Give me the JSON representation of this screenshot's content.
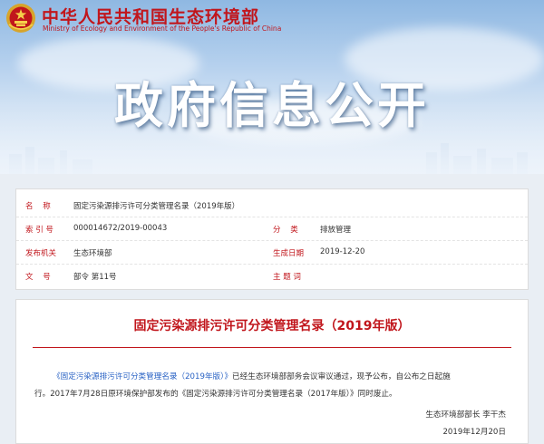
{
  "header": {
    "ministry_cn": "中华人民共和国生态环境部",
    "ministry_en": "Ministry of Ecology and Environment of the People's Republic of China",
    "banner_title": "政府信息公开",
    "emblem_icon": "national-emblem-icon"
  },
  "meta": {
    "name_label": "名    称",
    "name_value": "固定污染源排污许可分类管理名录（2019年版）",
    "index_label": "索 引 号",
    "index_value": "000014672/2019-00043",
    "category_label": "分    类",
    "category_value": "排放管理",
    "issuer_label": "发布机关",
    "issuer_value": "生态环境部",
    "date_label": "生成日期",
    "date_value": "2019-12-20",
    "docno_label": "文    号",
    "docno_value": "部令  第11号",
    "subject_label": "主 题 词",
    "subject_value": ""
  },
  "article": {
    "title": "固定污染源排污许可分类管理名录（2019年版）",
    "link_text": "《固定污染源排污许可分类管理名录（2019年版）》",
    "line1_rest": "已经生态环境部部务会议审议通过，现予公布，自公布之日起施",
    "line2": "行。2017年7月28日原环境保护部发布的《固定污染源排污许可分类管理名录（2017年版）》同时废止。",
    "signatory": "生态环境部部长  李干杰",
    "sign_date": "2019年12月20日"
  },
  "colors": {
    "accent_red": "#c1161c",
    "link_blue": "#2962c4",
    "banner_blue": "#8fb8e2"
  }
}
